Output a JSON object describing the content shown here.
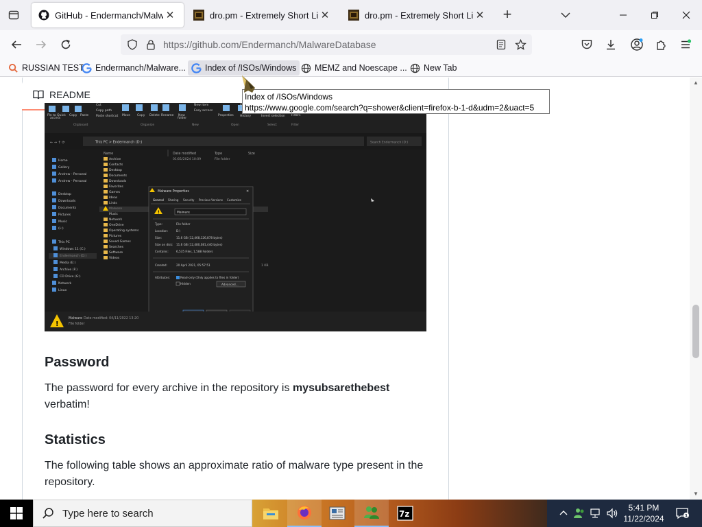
{
  "browser": {
    "tabs": [
      {
        "title": "GitHub - Endermanch/MalwareDatabase",
        "active": true,
        "icon": "github-icon"
      },
      {
        "title": "dro.pm - Extremely Short Links",
        "active": false,
        "icon": "dro-pm-icon"
      },
      {
        "title": "dro.pm - Extremely Short Links",
        "active": false,
        "icon": "dro-pm-icon"
      }
    ],
    "url": {
      "host": "https://github.com",
      "path": "/Endermanch/MalwareDatabase"
    },
    "bookmarks": [
      {
        "label": "RUSSIAN TEST",
        "icon": "search-icon"
      },
      {
        "label": "Endermanch/Malware...",
        "icon": "google-icon"
      },
      {
        "label": "Index of /ISOs/Windows",
        "icon": "google-icon"
      },
      {
        "label": "MEMZ and Noescape ...",
        "icon": "globe-icon"
      },
      {
        "label": "New Tab",
        "icon": "globe-icon"
      }
    ],
    "tooltip": {
      "title": "Index of /ISOs/Windows",
      "url": "https://www.google.com/search?q=shower&client=firefox-b-1-d&udm=2&uact=5"
    }
  },
  "readme": {
    "header": "README",
    "sections": {
      "password": {
        "heading": "Password",
        "text_before": "The password for every archive in the repository is ",
        "password": "mysubsarethebest",
        "text_after": "verbatim!"
      },
      "statistics": {
        "heading": "Statistics",
        "text": "The following table shows an approximate ratio of malware type present in the repository."
      }
    }
  },
  "embedded_screenshot": {
    "dialog_title": "Malware Properties",
    "tabs": [
      "General",
      "Sharing",
      "Security",
      "Previous Versions",
      "Customize"
    ],
    "name": "Malware",
    "rows": [
      {
        "label": "Type:",
        "value": "File folder"
      },
      {
        "label": "Location:",
        "value": "D:\\"
      },
      {
        "label": "Size:",
        "value": "11.6 GB (12,468,126,878 bytes)"
      },
      {
        "label": "Size on disk:",
        "value": "11.6 GB (12,480,081,440 bytes)"
      },
      {
        "label": "Contains:",
        "value": "6,535 Files, 1,588 Folders"
      },
      {
        "label": "Created:",
        "value": "20 April 2021, 05:57:51"
      },
      {
        "label": "Attributes:",
        "value": "Read-only (Only applies to files in folder)"
      }
    ],
    "hidden_label": "Hidden",
    "advanced_label": "Advanced...",
    "ok_label": "OK",
    "cancel_label": "Cancel",
    "apply_label": "Apply",
    "address": "This PC  >  Endermanch (D:)",
    "search_placeholder": "Search Endermanch (D:)",
    "columns": [
      "Name",
      "Date modified",
      "Type",
      "Size"
    ],
    "first_row": {
      "date": "01/01/2024 10:09",
      "type": "File folder"
    },
    "extra_size": "1 KB",
    "status": {
      "name": "Malware",
      "date": "Date modified: 04/11/2022 13:20",
      "type": "File folder"
    },
    "ribbon": [
      "Pin to Quick access",
      "Copy",
      "Paste",
      "Cut",
      "Copy path",
      "Paste shortcut",
      "Move to",
      "Copy to",
      "Delete",
      "Rename",
      "New folder",
      "New item",
      "Easy access",
      "Properties",
      "Open",
      "Edit",
      "History",
      "Select none",
      "Invert selection",
      "Filters"
    ],
    "ribbon_groups": [
      "Clipboard",
      "Organize",
      "New",
      "Open",
      "Select",
      "Filter"
    ],
    "nav_left": [
      "Home",
      "Gallery",
      "Andrew - Personal",
      "Andrew - Personal",
      "Desktop",
      "Downloads",
      "Documents",
      "Pictures",
      "Music",
      "(L:)",
      "This PC",
      "Windows 11 (C:)",
      "Endermanch (D:)",
      "Media (E:)",
      "Archive (F:)",
      "CD Drive (G:)",
      "Network",
      "Linux"
    ],
    "nav_right": [
      "Archive",
      "Contacts",
      "Desktop",
      "Documents",
      "Downloads",
      "Favorites",
      "Games",
      "Ideas",
      "Links",
      "Malware",
      "Music",
      "Network",
      "OneDrive",
      "Operating systems",
      "Pictures",
      "Saved Games",
      "Searches",
      "Software",
      "Videos"
    ]
  },
  "taskbar": {
    "search_placeholder": "Type here to search",
    "apps": [
      "file-explorer-icon",
      "firefox-icon",
      "news-app-icon",
      "people-app-icon",
      "7zip-icon"
    ],
    "time": "5:41 PM",
    "date": "11/22/2024"
  },
  "colors": {
    "accent_underline": "#fd8c73",
    "taskbar": "#1c2a44",
    "tab_strip": "#f0f0f4"
  }
}
